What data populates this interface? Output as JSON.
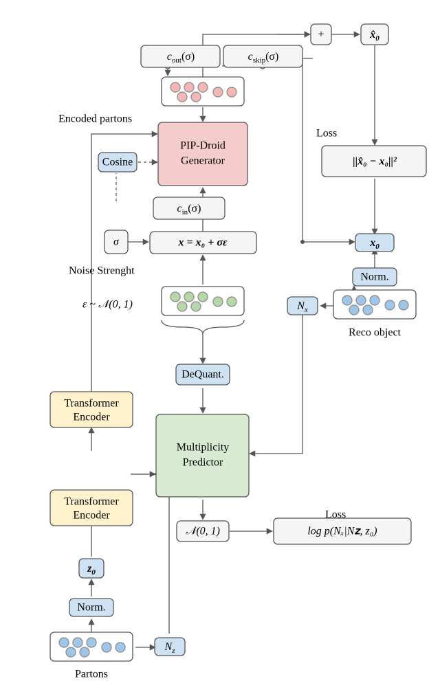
{
  "labels": {
    "enc_partons": "Encoded partons",
    "noise_str": "Noise Strenght",
    "loss1": "Loss",
    "loss2": "Loss",
    "reco": "Reco object",
    "partons": "Partons",
    "eps": "ε ~ 𝒩(0, 1)"
  },
  "b": {
    "cout": "c",
    "cout_sub": "out",
    "sigma": "(σ)",
    "cskip": "c",
    "cskip_sub": "skip",
    "cin": "c",
    "cin_sub": "in",
    "plus": "+",
    "xhat": "x̂",
    "zero": "0",
    "pip1": "PIP-Droid",
    "pip2": "Generator",
    "cos": "Cosine",
    "sig": "σ",
    "xexpr": "x = x₀ + σε",
    "x0": "x",
    "x0_sub": "0",
    "norm1": "Norm.",
    "norm2": "Norm.",
    "nx": "N",
    "nx_sub": "x",
    "nz": "N",
    "nz_sub": "z",
    "z0": "z",
    "z0_sub": "0",
    "te1a": "Transformer",
    "te1b": "Encoder",
    "te2a": "Transformer",
    "te2b": "Encoder",
    "dq": "DeQuant.",
    "mp1": "Multiplicity",
    "mp2": "Predictor",
    "n01": "𝒩(0, 1)",
    "loss_a": "||x̂₀ − x₀||²",
    "loss_b": "log p(Nₓ|N𝐳, z₀)"
  }
}
